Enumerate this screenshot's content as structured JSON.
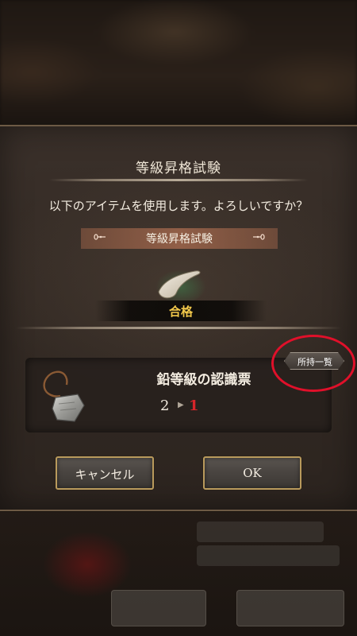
{
  "dialog": {
    "title": "等級昇格試験",
    "message": "以下のアイテムを使用します。よろしいですか？",
    "item_banner": "等級昇格試験",
    "result_label": "合格"
  },
  "item": {
    "name": "鉛等級の認識票",
    "quantity_before": "2",
    "quantity_after": "1",
    "arrow": "▶"
  },
  "owned_list_button": {
    "label": "所持一覧"
  },
  "buttons": {
    "cancel": "キャンセル",
    "ok": "OK"
  },
  "icons": {
    "banner_left": "ornament-left-icon",
    "banner_right": "ornament-right-icon",
    "item_reward": "horn-icon",
    "item_tag": "identification-tag-icon"
  },
  "colors": {
    "result_text": "#f2c84b",
    "quantity_after": "#d8252a",
    "highlight_ring": "#e0102a",
    "button_border": "#b99a5c"
  }
}
